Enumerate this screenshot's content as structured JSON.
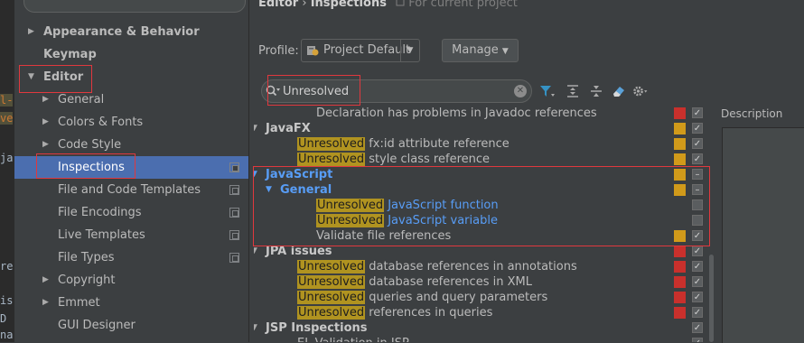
{
  "editor_fragments": [
    "l-",
    "ve",
    "ja",
    "re",
    "is",
    "D",
    "na"
  ],
  "sidebar": {
    "items": [
      {
        "label": "Appearance & Behavior",
        "level": 0,
        "expandable": true,
        "expanded": false,
        "bold": true
      },
      {
        "label": "Keymap",
        "level": 0,
        "expandable": false,
        "bold": true
      },
      {
        "label": "Editor",
        "level": 0,
        "expandable": true,
        "expanded": true,
        "bold": true
      },
      {
        "label": "General",
        "level": 1,
        "expandable": true,
        "expanded": false
      },
      {
        "label": "Colors & Fonts",
        "level": 1,
        "expandable": true,
        "expanded": false
      },
      {
        "label": "Code Style",
        "level": 1,
        "expandable": true,
        "expanded": false
      },
      {
        "label": "Inspections",
        "level": 1,
        "selected": true
      },
      {
        "label": "File and Code Templates",
        "level": 1
      },
      {
        "label": "File Encodings",
        "level": 1
      },
      {
        "label": "Live Templates",
        "level": 1
      },
      {
        "label": "File Types",
        "level": 1
      },
      {
        "label": "Copyright",
        "level": 1,
        "expandable": true,
        "expanded": false
      },
      {
        "label": "Emmet",
        "level": 1,
        "expandable": true,
        "expanded": false
      },
      {
        "label": "GUI Designer",
        "level": 1
      }
    ]
  },
  "header": {
    "breadcrumb_parent": "Editor",
    "breadcrumb_sep": "›",
    "breadcrumb_current": "Inspections",
    "breadcrumb_scope": "For current project"
  },
  "profile": {
    "label": "Profile:",
    "value": "Project Default",
    "manage_label": "Manage"
  },
  "search": {
    "value": "Unresolved"
  },
  "colors": {
    "highlight": "#b09320",
    "error": "#c9302c",
    "warning": "#d19a1a",
    "js_blue": "#589df6",
    "selection": "#4b6eaf",
    "annotation_red": "#e0383e"
  },
  "inspections": [
    {
      "level": 3,
      "type": "item",
      "text": "Declaration has problems in Javadoc references",
      "severity": "error",
      "checkbox": "checked"
    },
    {
      "level": 0,
      "type": "group",
      "expanded": true,
      "text": "JavaFX",
      "severity": "warning",
      "checkbox": "checked"
    },
    {
      "level": 2,
      "type": "item",
      "hl": "Unresolved",
      "text": " fx:id attribute reference",
      "severity": "warning",
      "checkbox": "checked"
    },
    {
      "level": 2,
      "type": "item",
      "hl": "Unresolved",
      "text": " style class reference",
      "severity": "warning",
      "checkbox": "checked"
    },
    {
      "level": 0,
      "type": "group",
      "expanded": true,
      "js": true,
      "text": "JavaScript",
      "severity": "warning",
      "checkbox": "partial"
    },
    {
      "level": 1,
      "type": "group",
      "expanded": true,
      "js": true,
      "text": "General",
      "severity": "warning",
      "checkbox": "partial"
    },
    {
      "level": 3,
      "type": "item",
      "hl": "Unresolved",
      "text": " JavaScript function",
      "link": true,
      "severity": "none",
      "checkbox": "unchecked"
    },
    {
      "level": 3,
      "type": "item",
      "hl": "Unresolved",
      "text": " JavaScript variable",
      "link": true,
      "severity": "none",
      "checkbox": "unchecked"
    },
    {
      "level": 3,
      "type": "item",
      "text": "Validate file references",
      "severity": "warning",
      "checkbox": "checked"
    },
    {
      "level": 0,
      "type": "group",
      "expanded": true,
      "text": "JPA issues",
      "severity": "error",
      "checkbox": "checked"
    },
    {
      "level": 2,
      "type": "item",
      "hl": "Unresolved",
      "text": " database references in annotations",
      "severity": "error",
      "checkbox": "checked"
    },
    {
      "level": 2,
      "type": "item",
      "hl": "Unresolved",
      "text": " database references in XML",
      "severity": "error",
      "checkbox": "checked"
    },
    {
      "level": 2,
      "type": "item",
      "hl": "Unresolved",
      "text": " queries and query parameters",
      "severity": "error",
      "checkbox": "checked"
    },
    {
      "level": 2,
      "type": "item",
      "hl": "Unresolved",
      "text": " references in queries",
      "severity": "error",
      "checkbox": "checked"
    },
    {
      "level": 0,
      "type": "group",
      "expanded": true,
      "text": "JSP Inspections",
      "severity": "none",
      "checkbox": "checked"
    },
    {
      "level": 2,
      "type": "item",
      "text": "EL Validation in JSP",
      "severity": "none",
      "checkbox": "checked"
    }
  ],
  "description": {
    "label": "Description"
  }
}
